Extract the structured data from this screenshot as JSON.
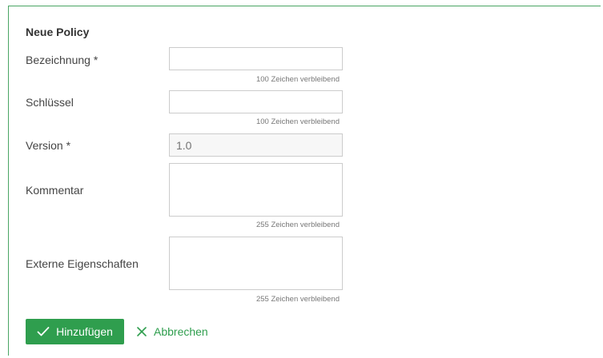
{
  "form": {
    "title": "Neue Policy",
    "fields": {
      "bezeichnung": {
        "label": "Bezeichnung *",
        "value": "",
        "hint": "100 Zeichen verbleibend"
      },
      "schluessel": {
        "label": "Schlüssel",
        "value": "",
        "hint": "100 Zeichen verbleibend"
      },
      "version": {
        "label": "Version *",
        "placeholder": "1.0"
      },
      "kommentar": {
        "label": "Kommentar",
        "value": "",
        "hint": "255 Zeichen verbleibend"
      },
      "externe_eigenschaften": {
        "label": "Externe Eigenschaften",
        "value": "",
        "hint": "255 Zeichen verbleibend"
      }
    },
    "actions": {
      "add_label": "Hinzufügen",
      "add_icon": "check-icon",
      "cancel_label": "Abbrechen",
      "cancel_icon": "close-icon"
    }
  },
  "colors": {
    "accent": "#2f9e4e",
    "border": "#4aa564"
  }
}
